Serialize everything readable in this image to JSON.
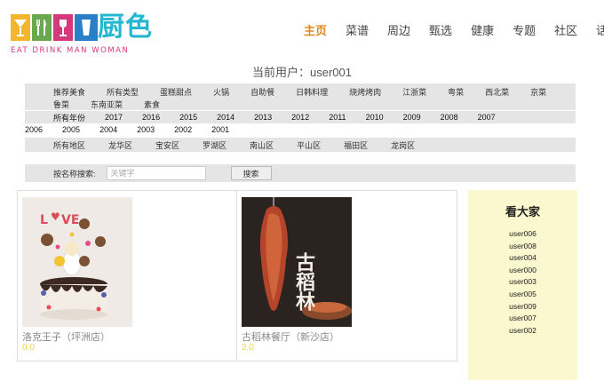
{
  "logo": {
    "cn": "厨色",
    "en": "EAT DRINK MAN WOMAN"
  },
  "nav": [
    "主页",
    "菜谱",
    "周边",
    "甄选",
    "健康",
    "专题",
    "社区",
    "话题"
  ],
  "current_user": "当前用户：user001",
  "filters": {
    "types_row1": [
      "推荐美食",
      "所有类型",
      "蛋糕甜点",
      "火锅",
      "自助餐",
      "日韩料理",
      "烧烤烤肉",
      "江浙菜",
      "粤菜",
      "西北菜",
      "京菜"
    ],
    "types_row2": [
      "鲁菜",
      "东南亚菜",
      "素食"
    ],
    "years_row1": [
      "所有年份",
      "2017",
      "2016",
      "2015",
      "2014",
      "2013",
      "2012",
      "2011",
      "2010",
      "2009",
      "2008",
      "2007"
    ],
    "years_row2": [
      "2006",
      "2005",
      "2004",
      "2003",
      "2002",
      "2001"
    ],
    "areas": [
      "所有地区",
      "龙华区",
      "宝安区",
      "罗湖区",
      "南山区",
      "平山区",
      "福田区",
      "龙岗区"
    ]
  },
  "search": {
    "label": "按名称搜索:",
    "placeholder": "关键字",
    "button": "搜索"
  },
  "results": [
    {
      "title": "洛克王子（坪洲店）",
      "score": "0.0",
      "image": "cake-photo"
    },
    {
      "title": "古稻林餐厅（新沙店）",
      "score": "2.0",
      "image": "roast-duck-poster",
      "poster_text": "古稻林"
    }
  ],
  "side": {
    "title": "看大家",
    "users": [
      "user006",
      "user008",
      "user004",
      "user000",
      "user003",
      "user005",
      "user009",
      "user007",
      "user002"
    ]
  },
  "colors": {
    "nav_active": "#e08a1e",
    "logo_cn": "#25b6d0",
    "logo_en": "#d6387c",
    "side_bg": "#fbf7cf",
    "score": "#f2d24a"
  }
}
